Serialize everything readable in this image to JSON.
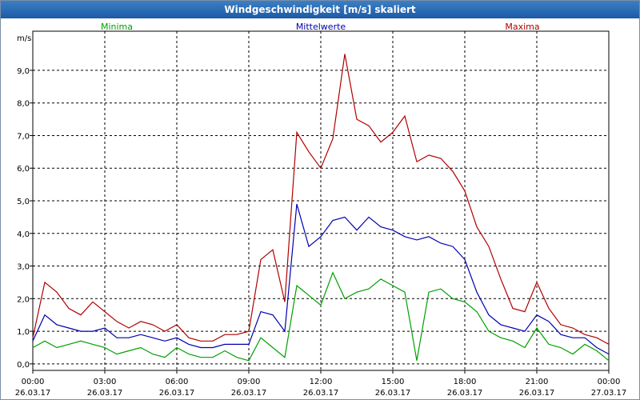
{
  "window": {
    "title": "Windgeschwindigkeit [m/s] skaliert"
  },
  "chart_data": {
    "type": "line",
    "title": "Windgeschwindigkeit [m/s] skaliert",
    "ylabel": "m/s",
    "xlabel": "",
    "ylim": [
      -0.2,
      10.2
    ],
    "xlim": [
      0,
      24
    ],
    "grid": true,
    "legend_position": "top",
    "yticks": [
      "0,0",
      "1,0",
      "2,0",
      "3,0",
      "4,0",
      "5,0",
      "6,0",
      "7,0",
      "8,0",
      "9,0"
    ],
    "ytick_values": [
      0,
      1,
      2,
      3,
      4,
      5,
      6,
      7,
      8,
      9
    ],
    "xtick_values": [
      0,
      3,
      6,
      9,
      12,
      15,
      18,
      21,
      24
    ],
    "xticks": [
      {
        "time": "00:00",
        "date": "26.03.17"
      },
      {
        "time": "03:00",
        "date": "26.03.17"
      },
      {
        "time": "06:00",
        "date": "26.03.17"
      },
      {
        "time": "09:00",
        "date": "26.03.17"
      },
      {
        "time": "12:00",
        "date": "26.03.17"
      },
      {
        "time": "15:00",
        "date": "26.03.17"
      },
      {
        "time": "18:00",
        "date": "26.03.17"
      },
      {
        "time": "21:00",
        "date": "26.03.17"
      },
      {
        "time": "00:00",
        "date": "27.03.17"
      }
    ],
    "x_hours": [
      0,
      0.5,
      1,
      1.5,
      2,
      2.5,
      3,
      3.5,
      4,
      4.5,
      5,
      5.5,
      6,
      6.5,
      7,
      7.5,
      8,
      8.5,
      9,
      9.5,
      10,
      10.5,
      11,
      11.5,
      12,
      12.5,
      13,
      13.5,
      14,
      14.5,
      15,
      15.5,
      16,
      16.5,
      17,
      17.5,
      18,
      18.5,
      19,
      19.5,
      20,
      20.5,
      21,
      21.5,
      22,
      22.5,
      23,
      23.5,
      24
    ],
    "series": [
      {
        "name": "Minima",
        "color": "#00a000",
        "values": [
          0.5,
          0.7,
          0.5,
          0.6,
          0.7,
          0.6,
          0.5,
          0.3,
          0.4,
          0.5,
          0.3,
          0.2,
          0.5,
          0.3,
          0.2,
          0.2,
          0.4,
          0.2,
          0.1,
          0.8,
          0.5,
          0.2,
          2.4,
          2.1,
          1.8,
          2.8,
          2.0,
          2.2,
          2.3,
          2.6,
          2.4,
          2.2,
          0.1,
          2.2,
          2.3,
          2.0,
          1.9,
          1.6,
          1.0,
          0.8,
          0.7,
          0.5,
          1.1,
          0.6,
          0.5,
          0.3,
          0.6,
          0.4,
          0.1
        ]
      },
      {
        "name": "Mittelwerte",
        "color": "#0000b0",
        "values": [
          0.7,
          1.5,
          1.2,
          1.1,
          1.0,
          1.0,
          1.1,
          0.8,
          0.8,
          0.9,
          0.8,
          0.7,
          0.8,
          0.6,
          0.5,
          0.5,
          0.6,
          0.6,
          0.6,
          1.6,
          1.5,
          1.0,
          4.9,
          3.6,
          3.9,
          4.4,
          4.5,
          4.1,
          4.5,
          4.2,
          4.1,
          3.9,
          3.8,
          3.9,
          3.7,
          3.6,
          3.2,
          2.2,
          1.5,
          1.2,
          1.1,
          1.0,
          1.5,
          1.3,
          0.9,
          0.8,
          0.8,
          0.5,
          0.3
        ]
      },
      {
        "name": "Maxima",
        "color": "#b00000",
        "values": [
          0.8,
          2.5,
          2.2,
          1.7,
          1.5,
          1.9,
          1.6,
          1.3,
          1.1,
          1.3,
          1.2,
          1.0,
          1.2,
          0.8,
          0.7,
          0.7,
          0.9,
          0.9,
          1.0,
          3.2,
          3.5,
          1.9,
          7.1,
          6.5,
          6.0,
          6.9,
          9.5,
          7.5,
          7.3,
          6.8,
          7.1,
          7.6,
          6.2,
          6.4,
          6.3,
          5.9,
          5.3,
          4.2,
          3.6,
          2.6,
          1.7,
          1.6,
          2.5,
          1.7,
          1.2,
          1.1,
          0.9,
          0.8,
          0.6
        ]
      }
    ]
  }
}
